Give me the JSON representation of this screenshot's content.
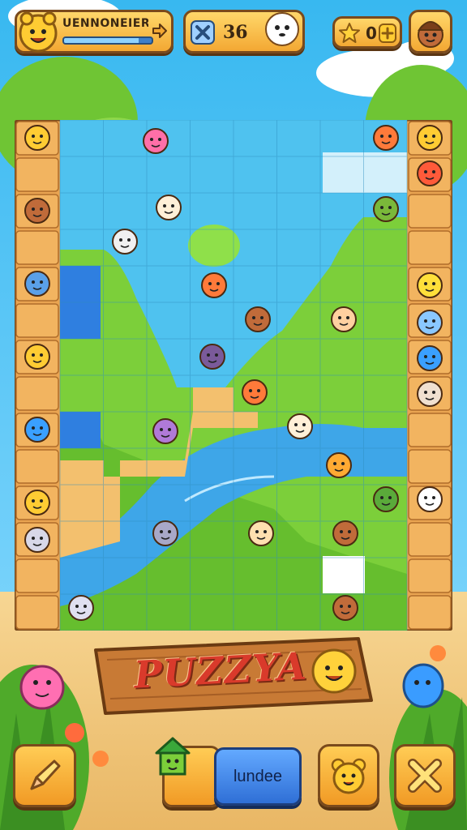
{
  "hud": {
    "level_title": "UENNONEIER",
    "level_progress": 0.85,
    "moves_count": "36",
    "stars_count": "0"
  },
  "banner": {
    "title": "PUZZYA"
  },
  "buttons": {
    "home_label": "lundee"
  },
  "colors": {
    "sky": "#4fc3f0",
    "grass": "#7ccf3a",
    "water": "#3ea6e8",
    "sand": "#f3c06e",
    "wood": "#d98a3a",
    "blue_button": "#3a7fe0"
  },
  "icons": [
    "sun-face-icon",
    "arrow-icon",
    "cross-icon",
    "ghost-icon",
    "star-icon",
    "plus-icon",
    "avatar-icon",
    "hint-pencil-icon",
    "house-icon",
    "bear-icon",
    "close-x-icon"
  ]
}
